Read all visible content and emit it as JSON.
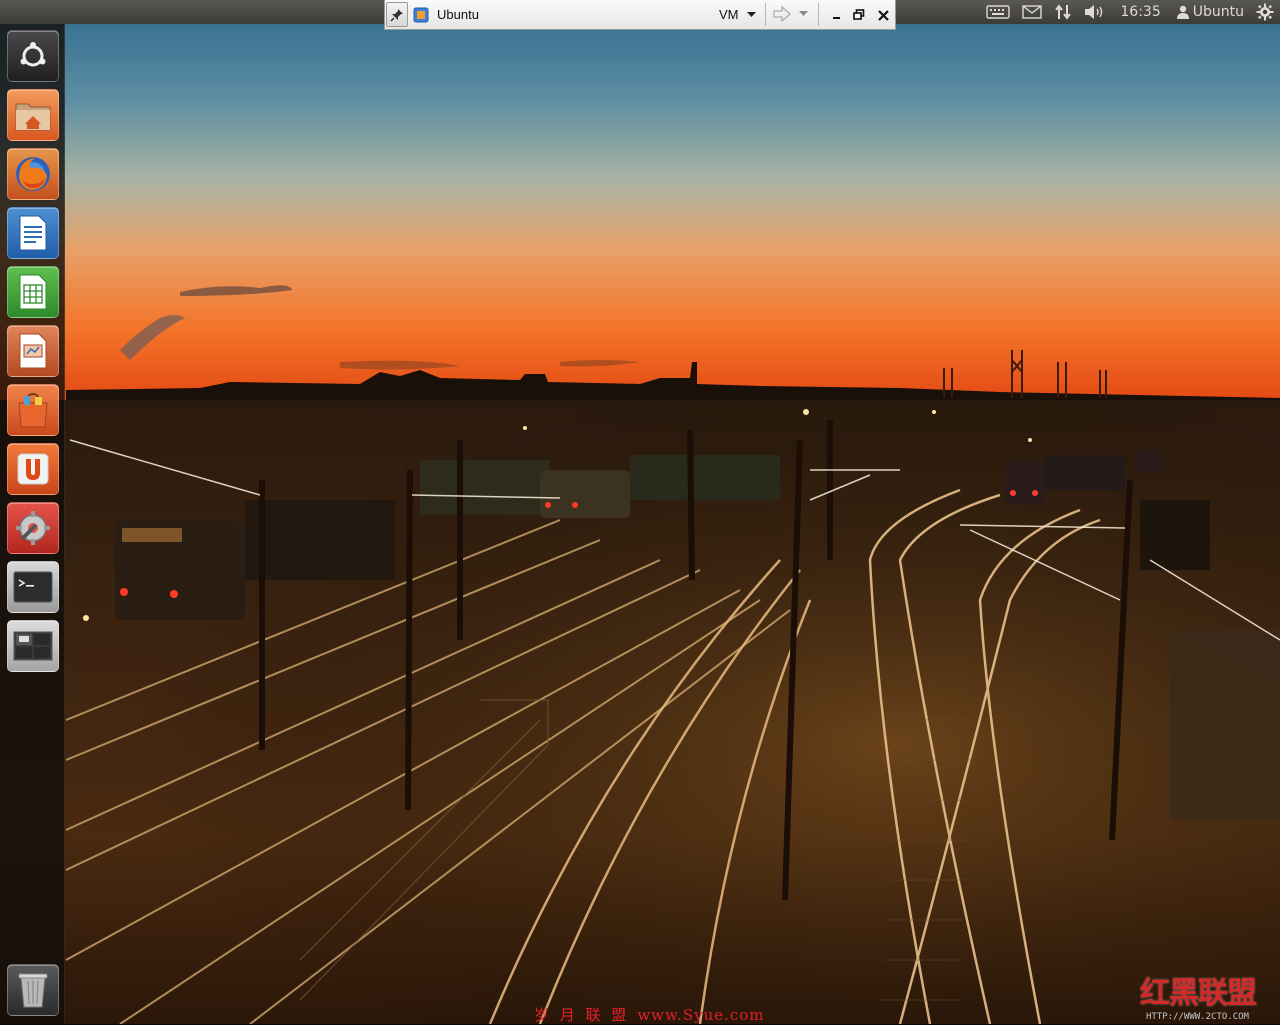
{
  "top_panel": {
    "clock": "16:35",
    "user_name": "Ubuntu",
    "indicators": [
      "keyboard-icon",
      "mail-icon",
      "network-icon",
      "volume-icon"
    ],
    "session_icon": "gear-icon"
  },
  "vm_toolbar": {
    "vm_name": "Ubuntu",
    "vm_menu_label": "VM",
    "buttons": [
      "pin-icon",
      "forward-arrow-icon",
      "minimize-icon",
      "restore-icon",
      "close-icon"
    ]
  },
  "launcher": {
    "items": [
      {
        "name": "dash-home",
        "icon": "ubuntu-logo-icon"
      },
      {
        "name": "home-folder",
        "icon": "home-folder-icon"
      },
      {
        "name": "firefox",
        "icon": "firefox-icon"
      },
      {
        "name": "libreoffice-writer",
        "icon": "writer-icon"
      },
      {
        "name": "libreoffice-calc",
        "icon": "calc-icon"
      },
      {
        "name": "libreoffice-impress",
        "icon": "impress-icon"
      },
      {
        "name": "software-center",
        "icon": "shopping-bag-icon"
      },
      {
        "name": "ubuntu-one",
        "icon": "ubuntu-one-icon"
      },
      {
        "name": "system-settings",
        "icon": "settings-wrench-icon"
      },
      {
        "name": "terminal",
        "icon": "terminal-icon"
      },
      {
        "name": "workspace-switcher",
        "icon": "workspaces-icon"
      },
      {
        "name": "trash",
        "icon": "trash-icon"
      }
    ]
  },
  "watermarks": {
    "left_text": "岁 月 联 盟",
    "left_url": "www.Syue.com",
    "right_text": "红黑联盟",
    "right_url": "HTTP://WWW.2CTO.COM"
  },
  "colors": {
    "panel": "#3c3b37",
    "panel_text": "#dfdbd2",
    "watermark_red": "#e3202a",
    "sky_top": "#3c6f8f",
    "horizon": "#f06a1a"
  }
}
